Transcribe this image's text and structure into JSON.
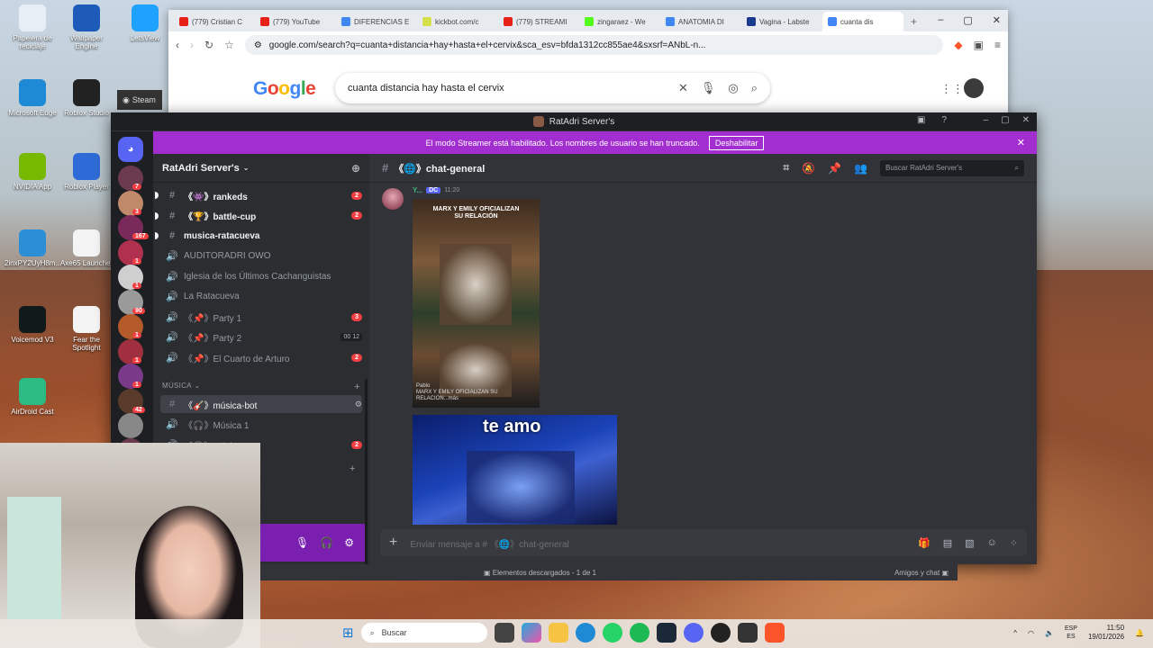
{
  "desktop": {
    "icons": [
      {
        "label": "Papelera de reciclaje",
        "color": "#e8eef5"
      },
      {
        "label": "Wallpaper Engine",
        "color": "#1e5bb8"
      },
      {
        "label": "LetsView",
        "color": "#1fa2ff"
      },
      {
        "label": "Microsoft Edge",
        "color": "#1e8ad6"
      },
      {
        "label": "Roblox Studio",
        "color": "#222222"
      },
      {
        "label": "NVIDIA App",
        "color": "#76b900"
      },
      {
        "label": "Roblox Player",
        "color": "#2e6bd6"
      },
      {
        "label": "2inxPY2UyH8m...",
        "color": "#2c8fd6"
      },
      {
        "label": "Axe65 Launcher",
        "color": "#f4f4f4"
      },
      {
        "label": "Voicemod V3",
        "color": "#101a1a"
      },
      {
        "label": "Fear the Spotlight",
        "color": "#f4f4f4"
      },
      {
        "label": "AirDroid Cast",
        "color": "#2dbb84"
      }
    ],
    "steam_tooltip": "Steam"
  },
  "browser": {
    "tabs": [
      {
        "label": "(779) Cristian C",
        "fav": "#e62117"
      },
      {
        "label": "(779) YouTube",
        "fav": "#e62117"
      },
      {
        "label": "DIFERENCIAS E",
        "fav": "#4285f4"
      },
      {
        "label": "kickbot.com/c",
        "fav": "#d6e04b"
      },
      {
        "label": "(779) STREAMI",
        "fav": "#e62117"
      },
      {
        "label": "zingaraez - We",
        "fav": "#53fc18"
      },
      {
        "label": "ANATOMIA DI",
        "fav": "#4285f4"
      },
      {
        "label": "Vagina - Labste",
        "fav": "#1a3a8f"
      },
      {
        "label": "cuanta dis",
        "fav": "#4285f4"
      }
    ],
    "url": "google.com/search?q=cuanta+distancia+hay+hasta+el+cervix&sca_esv=bfda1312cc855ae4&sxsrf=ANbL-n...",
    "logo": "Google",
    "query": "cuanta distancia hay hasta el cervix"
  },
  "discord": {
    "window_title": "RatAdri Server's",
    "streamer_notice": "El modo Streamer está habilitado. Los nombres de usuario se han truncado.",
    "disable_label": "Deshabilitar",
    "server_name": "RatAdri Server's",
    "guild_badges": [
      "7",
      "3",
      "167",
      "1",
      "1",
      "90",
      "1",
      "1",
      "1",
      "42"
    ],
    "channels": [
      {
        "sym": "#",
        "name": "《👾》rankeds",
        "badge": "2",
        "unread": true
      },
      {
        "sym": "#",
        "name": "《🏆》battle-cup",
        "badge": "2",
        "unread": true
      },
      {
        "sym": "#",
        "name": "musica-ratacueva",
        "badge": "",
        "unread": true
      },
      {
        "sym": "🔊",
        "name": "AUDITORADRI OWO",
        "badge": ""
      },
      {
        "sym": "🔊",
        "name": "Iglesia de los Últimos Cachanguistas",
        "badge": ""
      },
      {
        "sym": "🔊",
        "name": "La Ratacueva",
        "badge": ""
      },
      {
        "sym": "🔊",
        "name": "《📌》Party 1",
        "badge": "3"
      },
      {
        "sym": "🔊",
        "name": "《📌》Party 2",
        "badge": "",
        "users": "00 12"
      },
      {
        "sym": "🔊",
        "name": "《📌》El Cuarto de Arturo",
        "badge": "2"
      }
    ],
    "category_music": "MÚSICA",
    "music_channels": [
      {
        "sym": "#",
        "name": "《🎸》música-bot",
        "badge": ""
      },
      {
        "sym": "🔊",
        "name": "《🎧》Música 1",
        "badge": ""
      },
      {
        "sym": "🔊",
        "name": "《🎧》Música 2",
        "badge": "2"
      }
    ],
    "current_channel": "《🌐》chat-general",
    "search_placeholder": "Buscar RatAdri Server's",
    "message": {
      "author": "Y...",
      "tag": "DC",
      "time": "11:20",
      "image1_caption": "MARX Y EMILY OFICIALIZAN SU RELACIÓN",
      "image1_footer": "Pablo\nMARX Y EMILY OFICIALIZAN SU RELACIÓN...más",
      "image2_text": "te amo"
    },
    "composer_placeholder": "Enviar mensaje a # 《🌐》chat-general",
    "downloads": "Elementos descargados - 1 de 1",
    "friends_chat": "Amigos y chat"
  },
  "taskbar": {
    "search": "Buscar",
    "lang": "ESP\nES",
    "time": "11:50",
    "date": "19/01/2026"
  }
}
